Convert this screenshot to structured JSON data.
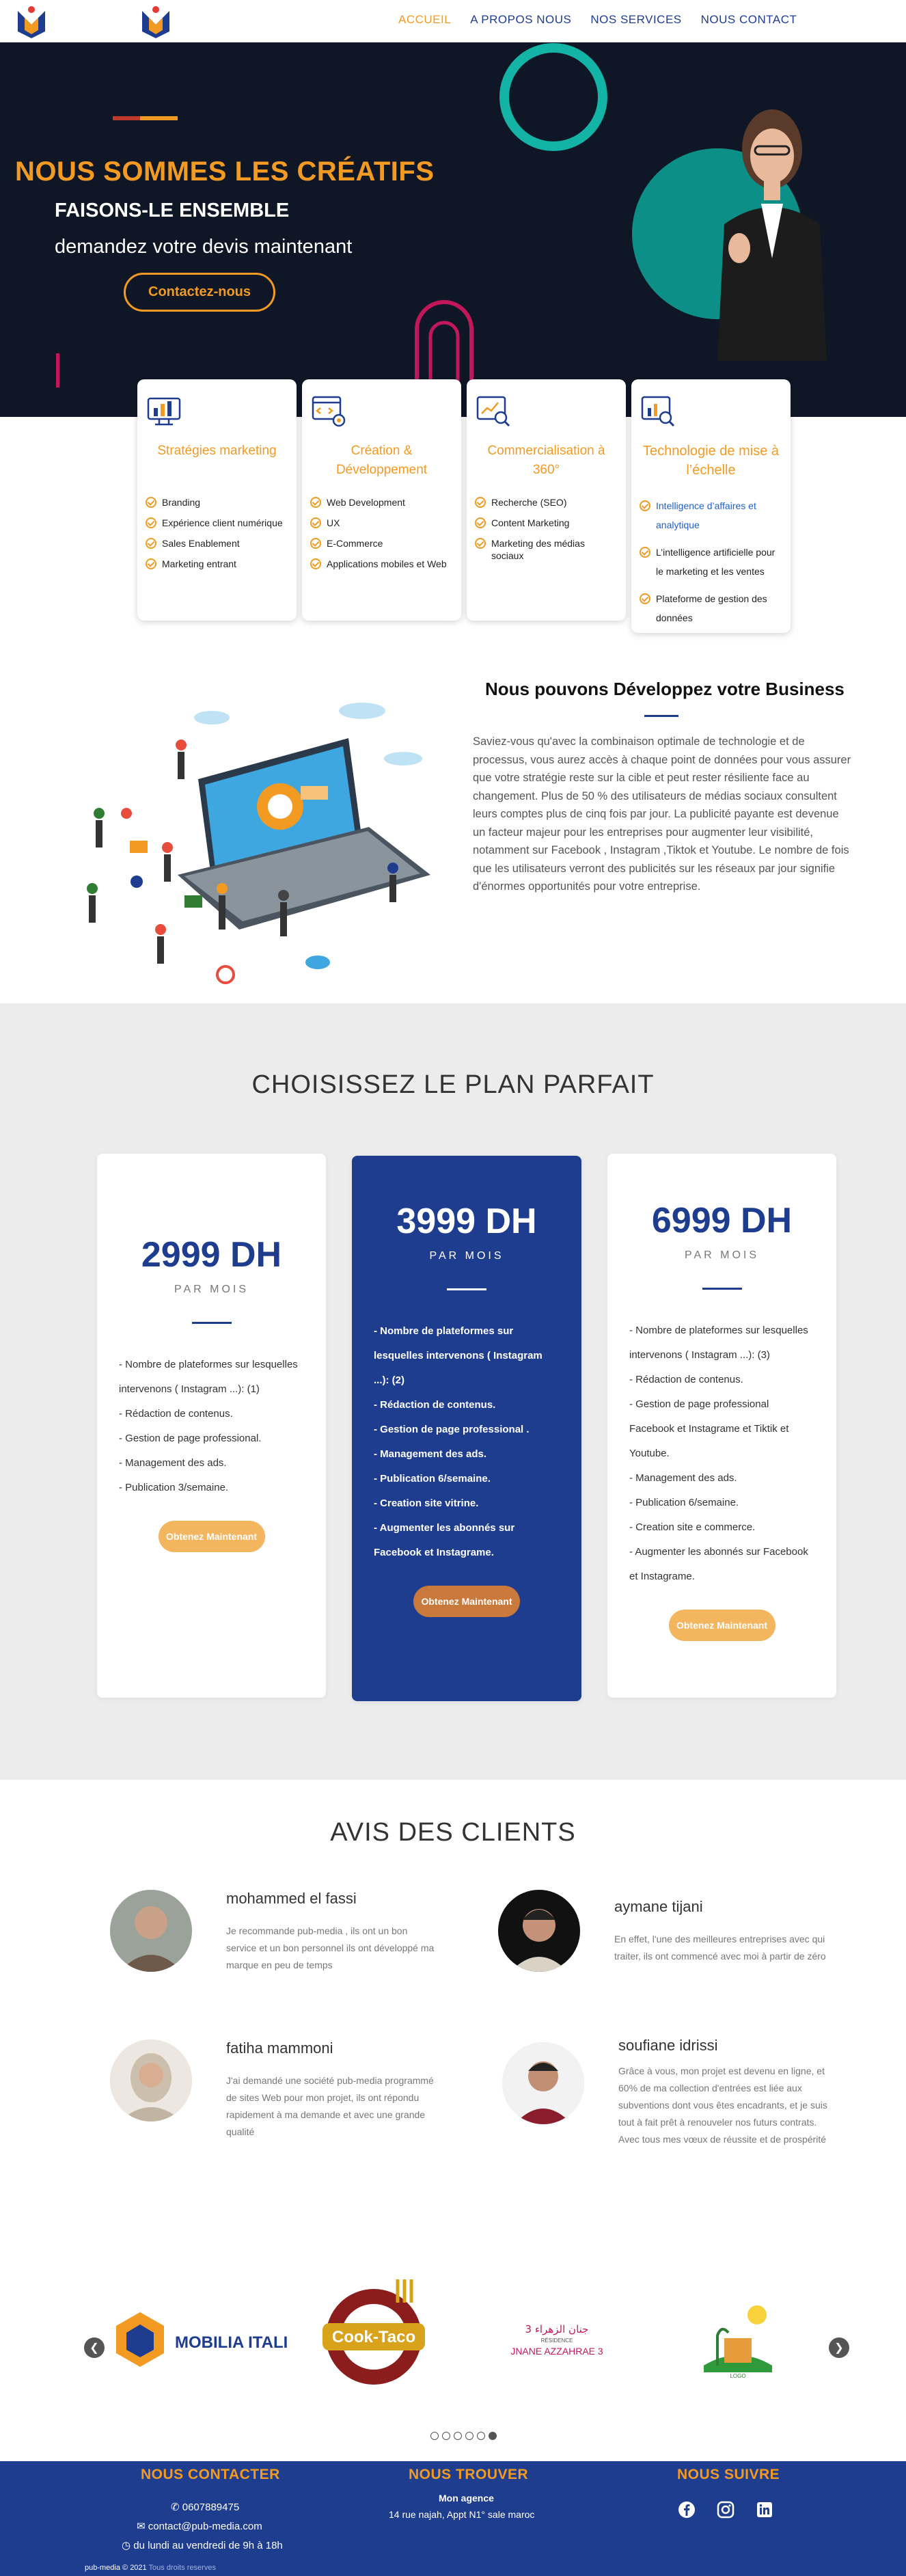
{
  "nav": {
    "items": [
      "ACCUEIL",
      "A PROPOS NOUS",
      "NOS SERVICES",
      "NOUS CONTACT"
    ]
  },
  "hero": {
    "title": "NOUS SOMMES LES CRÉATIFS",
    "subtitle": "FAISONS-LE ENSEMBLE",
    "line3": "demandez votre devis maintenant",
    "cta": "Contactez-nous"
  },
  "services": [
    {
      "title": "Stratégies marketing",
      "items": [
        "Branding",
        "Expérience client numérique",
        "Sales Enablement",
        "Marketing entrant"
      ]
    },
    {
      "title": "Création & Développement",
      "items": [
        "Web Development",
        "UX",
        "E-Commerce",
        "Applications mobiles et Web"
      ]
    },
    {
      "title": "Commercialisation à 360°",
      "items": [
        "Recherche (SEO)",
        "Content Marketing",
        "Marketing des médias sociaux"
      ]
    },
    {
      "title": "Technologie de mise à l’échelle",
      "items": [
        "Intelligence d’affaires et analytique",
        "L’intelligence artificielle pour le marketing et les ventes",
        "Plateforme de gestion des données"
      ]
    }
  ],
  "business": {
    "title": "Nous pouvons Développez votre Business",
    "text": "Saviez-vous qu'avec la combinaison optimale de technologie et de processus, vous aurez accès à chaque point de données pour vous assurer que votre stratégie reste sur la cible et peut rester résiliente face au changement. Plus de 50 % des utilisateurs de médias sociaux consultent leurs comptes plus de cinq fois par jour. La publicité payante est devenue un facteur majeur pour les entreprises pour augmenter leur visibilité, notamment sur Facebook , Instagram ,Tiktok et Youtube. Le nombre de fois que les utilisateurs verront des publicités sur les réseaux par jour signifie d'énormes opportunités pour votre entreprise."
  },
  "plans": {
    "title": "CHOISISSEZ LE PLAN PARFAIT",
    "items": [
      {
        "price": "2999 DH",
        "period": "PAR MOIS",
        "features": [
          "- Nombre de plateformes sur lesquelles intervenons ( Instagram ...): (1)",
          "- Rédaction de contenus.",
          "- Gestion de page professional.",
          "- Management des ads.",
          "- Publication 3/semaine."
        ],
        "button": "Obtenez Maintenant"
      },
      {
        "price": "3999 DH",
        "period": "PAR MOIS",
        "features": [
          "- Nombre de plateformes sur lesquelles intervenons ( Instagram ...): (2)",
          "- Rédaction de contenus.",
          "- Gestion de page professional .",
          "- Management des ads.",
          "- Publication 6/semaine.",
          "- Creation site vitrine.",
          "- Augmenter les abonnés sur Facebook et Instagrame."
        ],
        "button": "Obtenez Maintenant"
      },
      {
        "price": "6999 DH",
        "period": "PAR MOIS",
        "features": [
          "- Nombre de plateformes sur lesquelles intervenons ( Instagram ...): (3)",
          "- Rédaction de contenus.",
          "- Gestion de page professional Facebook et Instagrame et Tiktik et Youtube.",
          "- Management des ads.",
          "- Publication 6/semaine.",
          "- Creation site e commerce.",
          "- Augmenter les abonnés sur Facebook et Instagrame."
        ],
        "button": "Obtenez Maintenant"
      }
    ]
  },
  "reviews": {
    "title": "AVIS DES CLIENTS",
    "items": [
      {
        "name": "mohammed el fassi",
        "text": "Je recommande pub-media , ils ont un bon service et un bon personnel ils ont développé ma marque en peu de temps"
      },
      {
        "name": "aymane tijani",
        "text": "En effet, l'une des meilleures entreprises avec qui traiter, ils ont commencé avec moi à partir de zéro"
      },
      {
        "name": "fatiha mammoni",
        "text": "J'ai demandé une société pub-media programmé de sites Web pour mon projet, ils ont répondu rapidement à ma demande et avec une grande qualité"
      },
      {
        "name": "soufiane idrissi",
        "text": "Grâce à vous, mon projet est devenu en ligne, et 60% de ma collection d'entrées est liée aux subventions dont vous êtes encadrants, et je suis tout à fait prêt à renouveler nos futurs contrats. Avec tous mes vœux de réussite et de prospérité"
      }
    ]
  },
  "partners": {
    "mobilia": "MOBILIA ITALIA",
    "cooktaco": "Cook-Taco",
    "jnane_ar": "جنان الزهراء 3",
    "jnane": "JNANE AZZAHRAE 3",
    "jnane_tag": "RÉSIDENCE",
    "logo4_tag": "LOGO"
  },
  "footer": {
    "contact_title": "NOUS CONTACTER",
    "phone": "0607889475",
    "email": "contact@pub-media.com",
    "hours": "du lundi au vendredi de 9h à 18h",
    "find_title": "NOUS TROUVER",
    "agency": "Mon agence",
    "address": "14 rue najah, Appt N1° sale maroc",
    "follow_title": "NOUS SUIVRE",
    "copyright": "pub-media © 2021",
    "rights": "Tous droits reserves"
  },
  "colors": {
    "orange": "#f39a22",
    "navy": "#1e3d8f",
    "dark": "#0f1626"
  }
}
